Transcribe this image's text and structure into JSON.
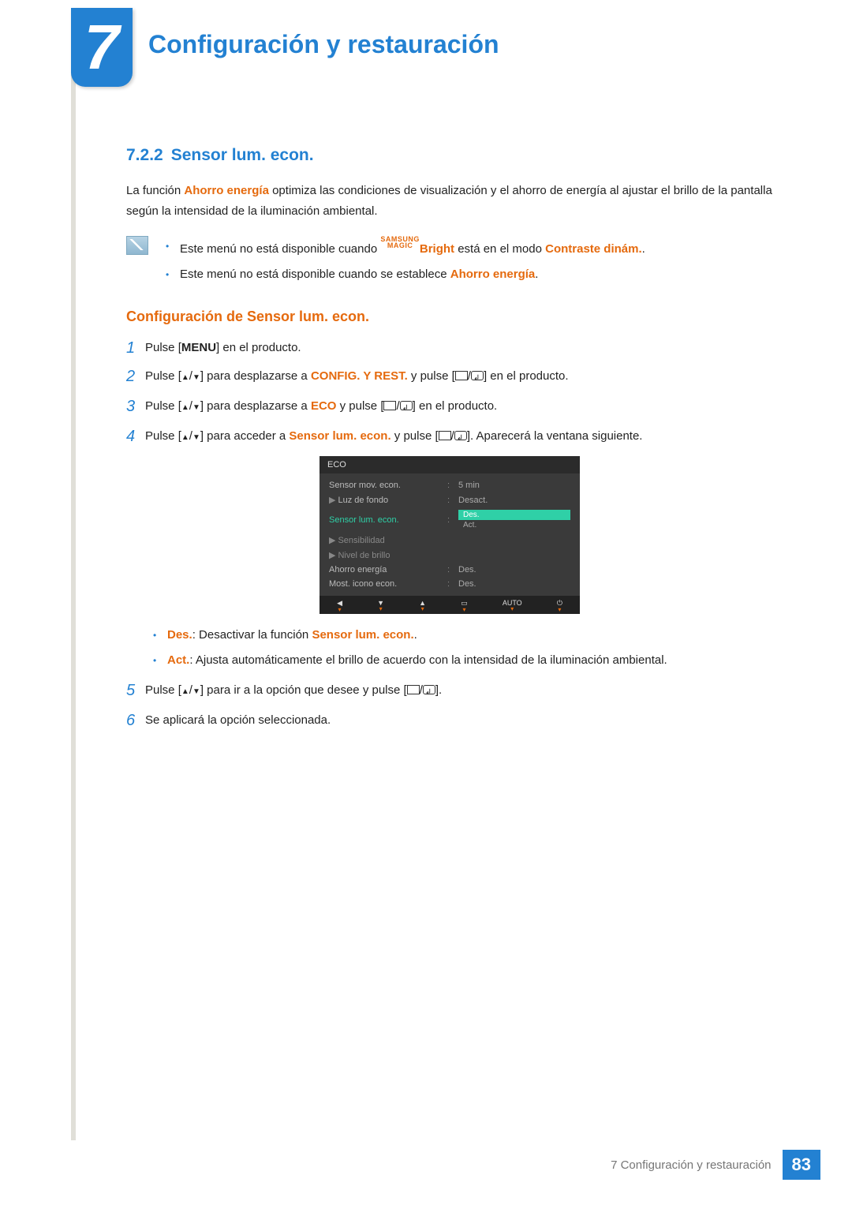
{
  "chapter": {
    "number": "7",
    "title": "Configuración y restauración"
  },
  "section": {
    "number": "7.2.2",
    "title": "Sensor lum. econ."
  },
  "intro": {
    "t1": "La función ",
    "term1": "Ahorro energía",
    "t2": " optimiza las condiciones de visualización y el ahorro de energía al ajustar el brillo de la pantalla según la intensidad de la iluminación ambiental."
  },
  "notes": {
    "n1a": "Este menú no está disponible cuando ",
    "samsung_top": "SAMSUNG",
    "samsung_bot": "MAGIC",
    "n1b": "Bright",
    "n1c": " está en el modo ",
    "n1d": "Contraste dinám.",
    "n1e": ".",
    "n2a": "Este menú no está disponible cuando se establece ",
    "n2b": "Ahorro energía",
    "n2c": "."
  },
  "config": {
    "heading": "Configuración de Sensor lum. econ.",
    "steps": {
      "s1": {
        "t1": "Pulse [",
        "menu": "MENU",
        "t2": "] en el producto."
      },
      "s2": {
        "t1": "Pulse [",
        "t2": "] para desplazarse a ",
        "target": "CONFIG. Y REST.",
        "t3": " y pulse [",
        "t4": "] en el producto."
      },
      "s3": {
        "t1": "Pulse [",
        "t2": "] para desplazarse a ",
        "target": "ECO",
        "t3": " y pulse [",
        "t4": "] en el producto."
      },
      "s4": {
        "t1": "Pulse [",
        "t2": "] para acceder a ",
        "target": "Sensor lum. econ.",
        "t3": " y pulse [",
        "t4": "]. Aparecerá la ventana siguiente."
      },
      "s5": {
        "t1": "Pulse [",
        "t2": "] para ir a la opción que desee y pulse [",
        "t3": "]."
      },
      "s6": {
        "t1": "Se aplicará la opción seleccionada."
      }
    }
  },
  "osd": {
    "title": "ECO",
    "rows": [
      {
        "label": "Sensor mov. econ.",
        "value": "5 min",
        "arrow": false,
        "dim": false
      },
      {
        "label": "Luz de fondo",
        "value": "Desact.",
        "arrow": true,
        "dim": false
      },
      {
        "label": "Sensor lum. econ.",
        "value": "",
        "arrow": false,
        "dim": false,
        "highlight": true,
        "options": [
          "Des.",
          "Act."
        ]
      },
      {
        "label": "Sensibilidad",
        "value": "",
        "arrow": true,
        "dim": true
      },
      {
        "label": "Nivel de brillo",
        "value": "",
        "arrow": true,
        "dim": true
      },
      {
        "label": "Ahorro energía",
        "value": "Des.",
        "arrow": false,
        "dim": false
      },
      {
        "label": "Most. icono econ.",
        "value": "Des.",
        "arrow": false,
        "dim": false
      }
    ],
    "footer": {
      "auto": "AUTO"
    }
  },
  "options": {
    "des": {
      "term": "Des.",
      "t1": ": Desactivar la función ",
      "t2": "Sensor lum. econ.",
      "t3": "."
    },
    "act": {
      "term": "Act.",
      "t1": ": Ajusta automáticamente el brillo de acuerdo con la intensidad de la iluminación ambiental."
    }
  },
  "footer": {
    "text": "7 Configuración y restauración",
    "page": "83"
  }
}
